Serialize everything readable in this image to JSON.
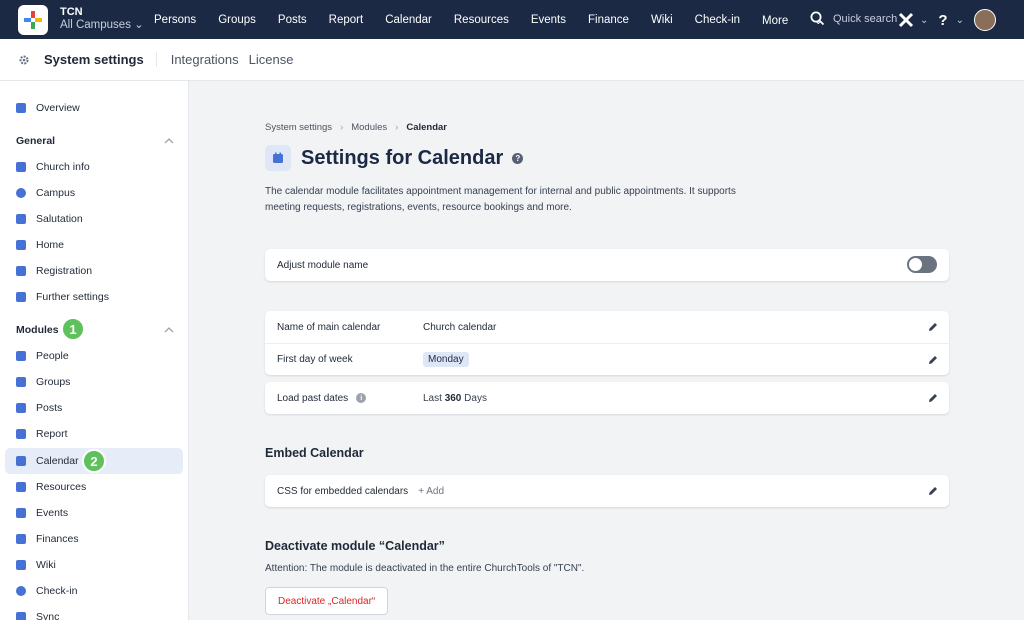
{
  "topbar": {
    "org_name": "TCN",
    "campus": "All Campuses",
    "nav": [
      "Persons",
      "Groups",
      "Posts",
      "Report",
      "Calendar",
      "Resources",
      "Events",
      "Finance",
      "Wiki",
      "Check-in",
      "More"
    ],
    "search_placeholder": "Quick search",
    "help": "?"
  },
  "subnav": {
    "title": "System settings",
    "tabs": [
      "Integrations",
      "License"
    ]
  },
  "sidebar": {
    "overview": "Overview",
    "general_head": "General",
    "general": [
      "Church info",
      "Campus",
      "Salutation",
      "Home",
      "Registration",
      "Further settings"
    ],
    "modules_head": "Modules",
    "modules": [
      "People",
      "Groups",
      "Posts",
      "Report",
      "Calendar",
      "Resources",
      "Events",
      "Finances",
      "Wiki",
      "Check-in",
      "Sync"
    ],
    "active": "Calendar",
    "badge1": "1",
    "badge2": "2"
  },
  "breadcrumb": [
    "System settings",
    "Modules",
    "Calendar"
  ],
  "page_title": "Settings for Calendar",
  "help_mark": "?",
  "description": "The calendar module facilitates appointment management for internal and public appointments. It supports meeting requests, registrations, events, resource bookings and more.",
  "adjust_name": {
    "label": "Adjust module name",
    "enabled": false
  },
  "settings": {
    "main_calendar_label": "Name of main calendar",
    "main_calendar_value": "Church calendar",
    "first_day_label": "First day of week",
    "first_day_value": "Monday",
    "past_dates_label": "Load past dates",
    "info_mark": "i",
    "past_prefix": "Last",
    "past_value": "360",
    "past_suffix": "Days"
  },
  "embed": {
    "heading": "Embed Calendar",
    "css_label": "CSS for embedded calendars",
    "add_label": "+ Add"
  },
  "deactivate": {
    "heading": "Deactivate module “Calendar”",
    "attention": "Attention: The module is deactivated in the entire ChurchTools of \"TCN\".",
    "button": "Deactivate „Calendar“"
  },
  "colors": {
    "topbar": "#1b2945",
    "accent": "#4672d6",
    "badge": "#5ec15b",
    "danger": "#dc2626"
  }
}
